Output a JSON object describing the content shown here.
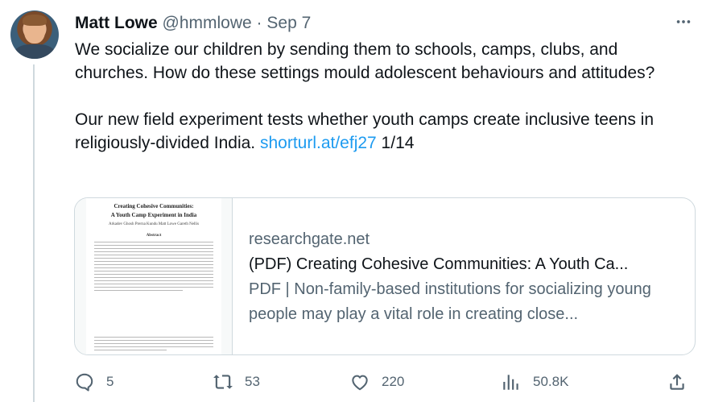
{
  "tweet": {
    "author_name": "Matt Lowe",
    "handle": "@hmmlowe",
    "separator": "·",
    "date": "Sep 7",
    "text_main": "We socialize our children by sending them to schools, camps, clubs, and churches. How do these settings mould adolescent behaviours and attitudes?\n\nOur new field experiment tests whether youth camps create inclusive teens in religiously-divided India. ",
    "link_text": "shorturl.at/efj27",
    "text_suffix": " 1/14"
  },
  "card": {
    "domain": "researchgate.net",
    "title": "(PDF) Creating Cohesive Communities: A Youth Ca...",
    "description": "PDF | Non-family-based institutions for socializing young people may play a vital role in creating close...",
    "thumbnail": {
      "paper_title_line1": "Creating Cohesive Communities:",
      "paper_title_line2": "A Youth Camp Experiment in India",
      "authors": "Arkadev Ghosh       Prerna Kundu       Matt Lowe       Gareth Nellis",
      "abstract_heading": "Abstract"
    }
  },
  "actions": {
    "replies": "5",
    "retweets": "53",
    "likes": "220",
    "views": "50.8K"
  },
  "colors": {
    "accent": "#1d9bf0",
    "secondary_text": "#536471",
    "border": "#cfd9de"
  },
  "icons": [
    "more-icon",
    "reply-icon",
    "retweet-icon",
    "like-icon",
    "views-icon",
    "share-icon"
  ]
}
